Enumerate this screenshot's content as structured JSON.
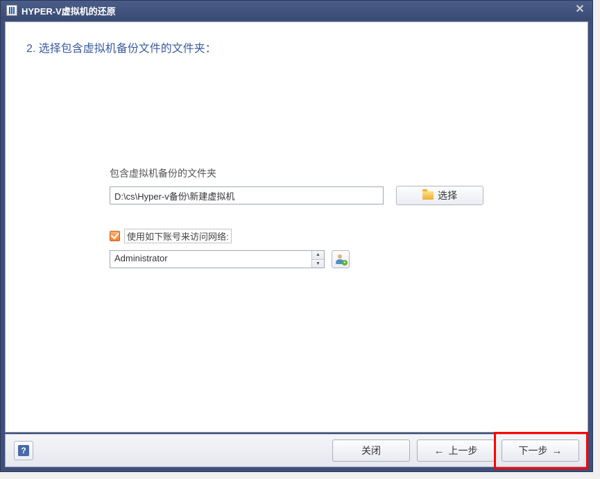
{
  "titlebar": {
    "title": "HYPER-V虚拟机的还原"
  },
  "step": {
    "heading": "2. 选择包含虚拟机备份文件的文件夹："
  },
  "folder": {
    "label": "包含虚拟机备份的文件夹",
    "path": "D:\\cs\\Hyper-v备份\\新建虚拟机",
    "browse_label": "选择"
  },
  "network": {
    "checkbox_label": "使用如下账号来访问网络:",
    "checked": true,
    "account": "Administrator"
  },
  "footer": {
    "close_label": "关闭",
    "prev_label": "上一步",
    "next_label": "下一步"
  }
}
